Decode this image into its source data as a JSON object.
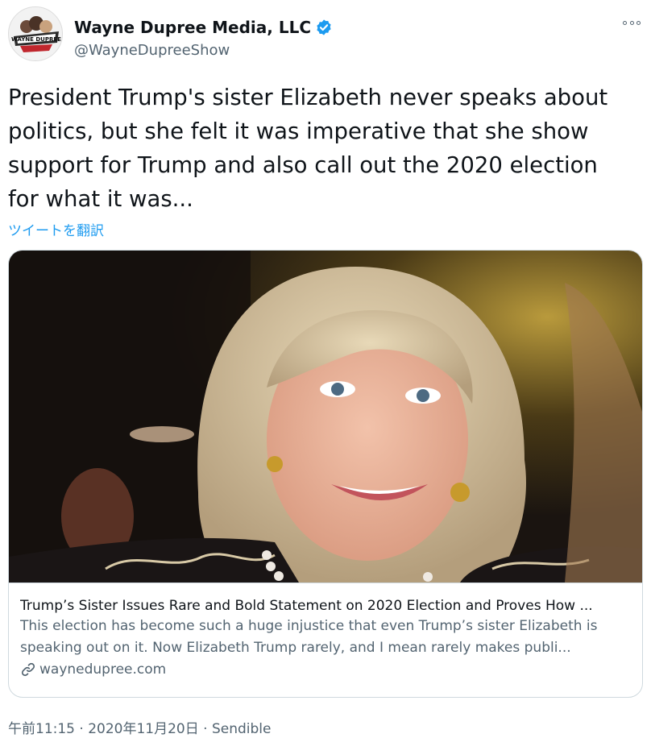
{
  "author": {
    "display_name": "Wayne Dupree Media, LLC",
    "handle": "@WayneDupreeShow",
    "avatar_text": "WAYNE DUPREE"
  },
  "tweet": {
    "text": "President Trump's sister Elizabeth never speaks about\npolitics, but she felt it was imperative that she show\nsupport for Trump and also call out the 2020 election\nfor what it was...",
    "translate_label": "ツイートを翻訳"
  },
  "card": {
    "title": "Trump’s Sister Issues Rare and Bold Statement on 2020 Election and Proves How ...",
    "description": "This election has become such a huge injustice that even Trump’s sister Elizabeth is speaking out on it. Now Elizabeth Trump rarely, and I mean rarely makes publi...",
    "domain": "waynedupree.com"
  },
  "meta": {
    "time": "午前11:15",
    "separator1": " · ",
    "date": "2020年11月20日",
    "separator2": " · ",
    "source": "Sendible"
  },
  "icons": {
    "verified": "verified-badge-icon",
    "more": "more-options-icon",
    "link": "link-icon"
  },
  "colors": {
    "accent": "#1d9bf0",
    "text": "#0f1419",
    "secondary": "#536471",
    "border": "#cfd9de"
  }
}
